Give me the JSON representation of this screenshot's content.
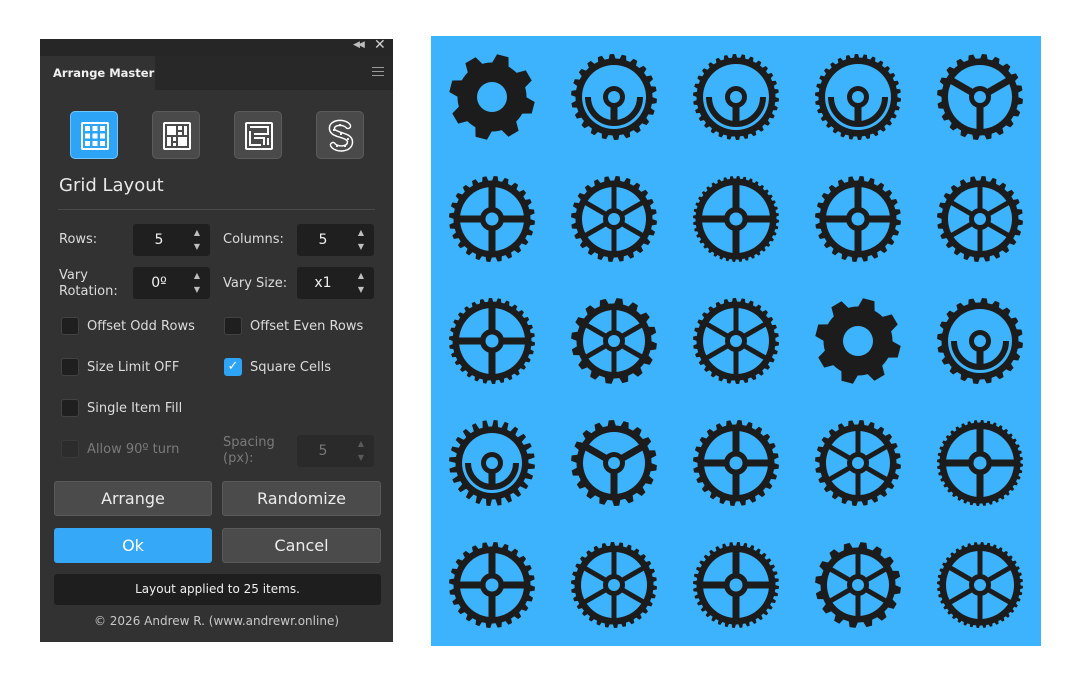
{
  "panel": {
    "tab_label": "Arrange Master",
    "section_title": "Grid Layout",
    "modes": [
      {
        "name": "grid-layout",
        "icon": "grid-icon",
        "active": true
      },
      {
        "name": "mosaic-layout",
        "icon": "mosaic-icon",
        "active": false
      },
      {
        "name": "maze-layout",
        "icon": "maze-icon",
        "active": false
      },
      {
        "name": "path-layout",
        "icon": "path-s-icon",
        "active": false
      }
    ],
    "fields": {
      "rows_label": "Rows:",
      "rows_value": "5",
      "columns_label": "Columns:",
      "columns_value": "5",
      "vary_rotation_label_1": "Vary",
      "vary_rotation_label_2": "Rotation:",
      "vary_rotation_value": "0º",
      "vary_size_label": "Vary Size:",
      "vary_size_value": "x1",
      "spacing_label_1": "Spacing",
      "spacing_label_2": "(px):",
      "spacing_value": "5"
    },
    "checkboxes": {
      "offset_odd_rows": {
        "label": "Offset Odd Rows",
        "checked": false,
        "enabled": true
      },
      "offset_even_rows": {
        "label": "Offset Even Rows",
        "checked": false,
        "enabled": true
      },
      "size_limit": {
        "label": "Size Limit OFF",
        "checked": false,
        "enabled": true
      },
      "square_cells": {
        "label": "Square Cells",
        "checked": true,
        "enabled": true
      },
      "single_item_fill": {
        "label": "Single Item Fill",
        "checked": false,
        "enabled": true
      },
      "allow_90_turn": {
        "label": "Allow 90º turn",
        "checked": false,
        "enabled": false
      }
    },
    "buttons": {
      "arrange": "Arrange",
      "randomize": "Randomize",
      "ok": "Ok",
      "cancel": "Cancel"
    },
    "status": "Layout applied to 25 items.",
    "copyright": "© 2026 Andrew R. (www.andrewr.online)"
  },
  "canvas": {
    "background": "#3db3fd",
    "gear_color": "#1c1c1c",
    "rows": 5,
    "columns": 5
  },
  "colors": {
    "panel_bg": "#323232",
    "accent": "#2ea4f6"
  }
}
